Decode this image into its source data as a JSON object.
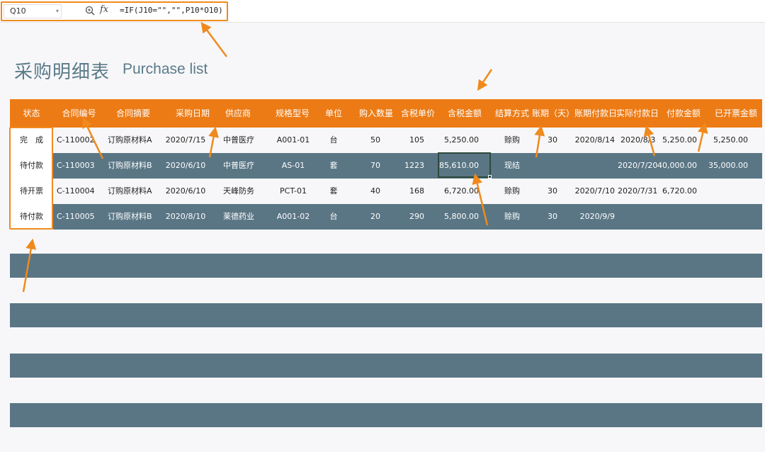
{
  "formula_bar": {
    "cell_ref": "Q10",
    "fx_label": "fx",
    "formula": "=IF(J10=\"\",\"\",P10*O10)"
  },
  "title": {
    "cn": "采购明细表",
    "en": "Purchase list"
  },
  "table": {
    "headers": [
      "状态",
      "合同编号",
      "合同摘要",
      "采购日期",
      "供应商",
      "规格型号",
      "单位",
      "购入数量",
      "含税单价",
      "含税金额",
      "结算方式",
      "账期（天）",
      "账期付款日",
      "实际付款日",
      "付款金额",
      "已开票金额"
    ],
    "rows": [
      [
        "完　成",
        "C-110002",
        "订购原材料A",
        "2020/7/15",
        "中普医疗",
        "A001-01",
        "台",
        "50",
        "105",
        "5,250.00",
        "赊购",
        "30",
        "2020/8/14",
        "2020/8/3",
        "5,250.00",
        "5,250.00"
      ],
      [
        "待付款",
        "C-110003",
        "订购原材料B",
        "2020/6/10",
        "中普医疗",
        "AS-01",
        "套",
        "70",
        "1223",
        "85,610.00",
        "现结",
        "",
        "",
        "2020/7/20",
        "40,000.00",
        "35,000.00"
      ],
      [
        "待开票",
        "C-110004",
        "订购原材料A",
        "2020/6/10",
        "天峰防务",
        "PCT-01",
        "套",
        "40",
        "168",
        "6,720.00",
        "赊购",
        "30",
        "2020/7/10",
        "2020/7/31",
        "6,720.00",
        ""
      ],
      [
        "待付款",
        "C-110005",
        "订购原材料B",
        "2020/8/10",
        "莱德药业",
        "A001-02",
        "台",
        "20",
        "290",
        "5,800.00",
        "赊购",
        "30",
        "2020/9/9",
        "",
        "",
        ""
      ]
    ]
  },
  "colors": {
    "header": "#ec7b15",
    "dark_row": "#5a7685",
    "highlight": "#f08a1d",
    "title": "#5a7a88"
  }
}
